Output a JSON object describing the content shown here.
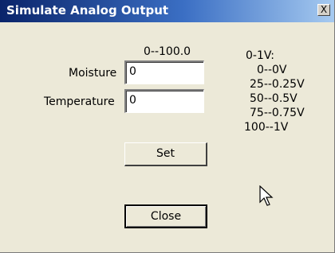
{
  "window": {
    "title": "Simulate Analog Output",
    "close_label": "X"
  },
  "range_label": "0--100.0",
  "fields": [
    {
      "label": "Moisture",
      "value": "0"
    },
    {
      "label": "Temperature",
      "value": "0"
    }
  ],
  "legend": {
    "title": "0-1V:",
    "lines": [
      "0--0V",
      "25--0.25V",
      "50--0.5V",
      "75--0.75V",
      "100--1V"
    ]
  },
  "buttons": {
    "set": "Set",
    "close": "Close"
  },
  "icons": {
    "cursor": "mouse-pointer-icon"
  }
}
